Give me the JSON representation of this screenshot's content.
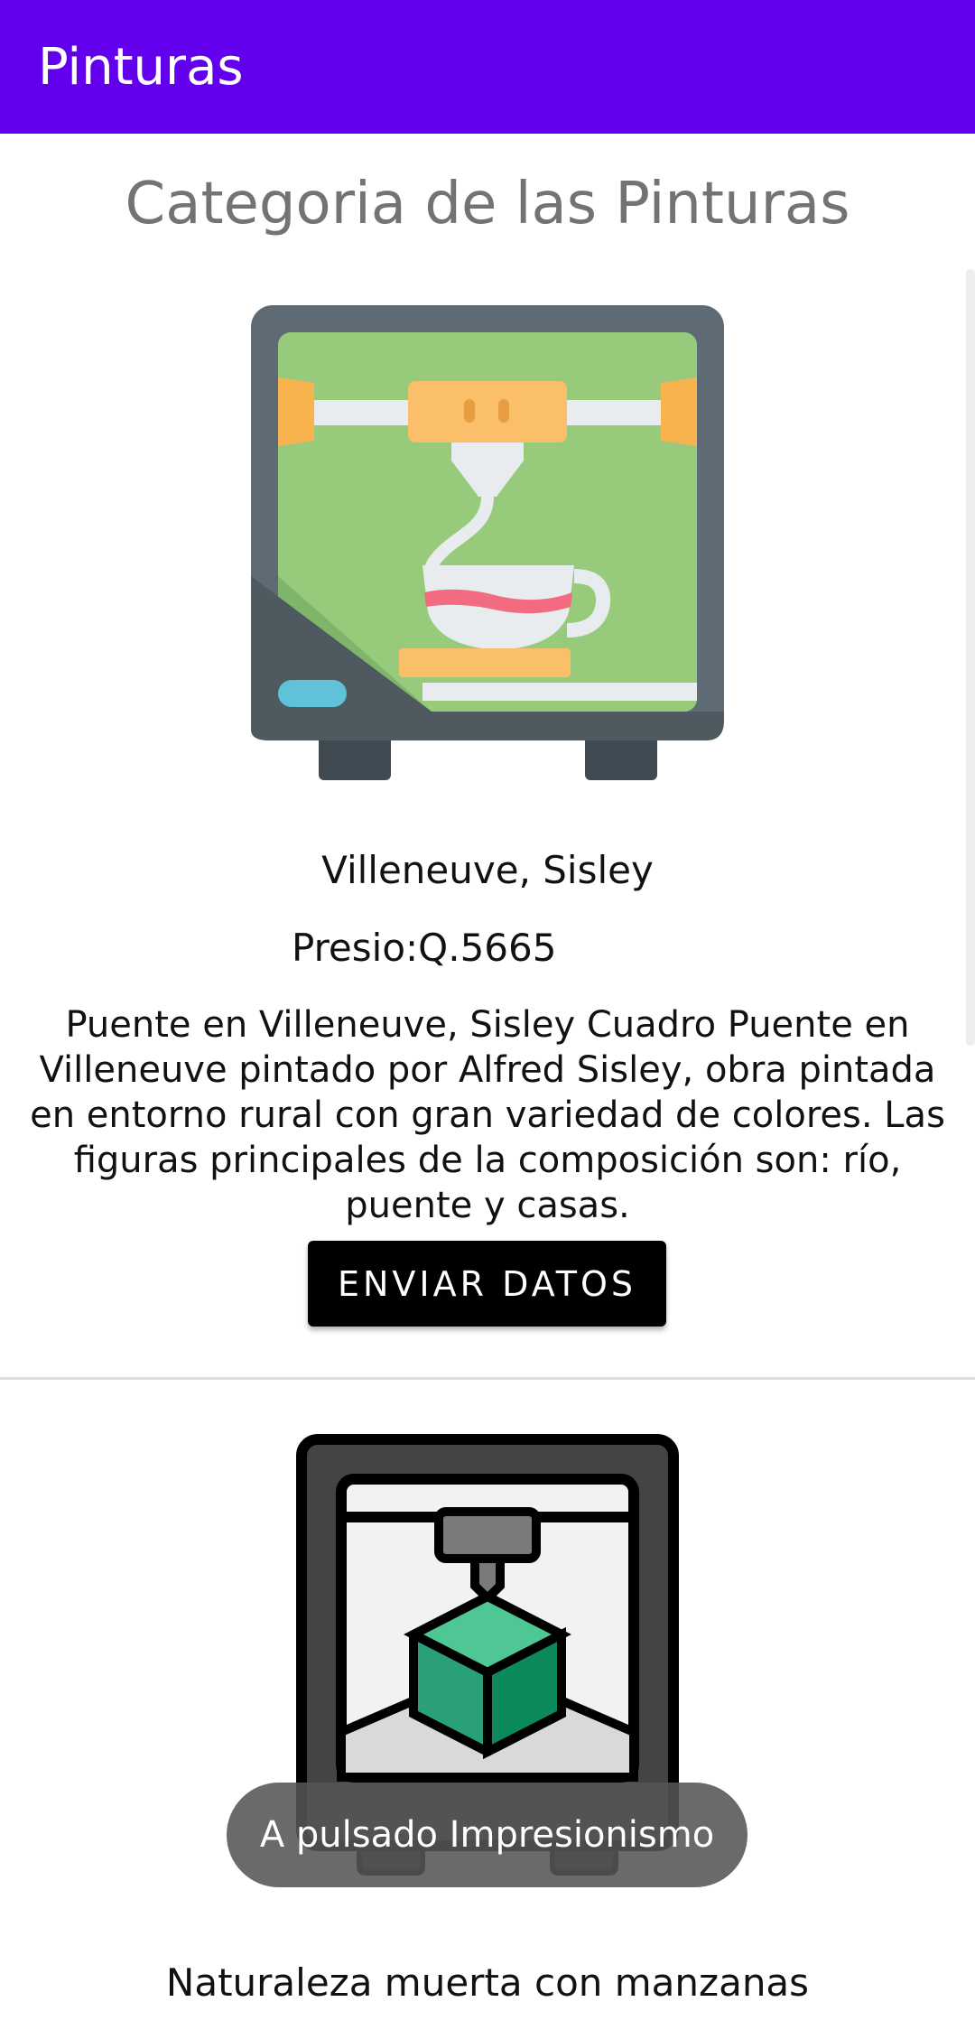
{
  "app_bar": {
    "title": "Pinturas",
    "color": "#6200EE"
  },
  "page": {
    "heading": "Categoria de las Pinturas"
  },
  "items": [
    {
      "icon": "3d-printer-coffee-cup-icon",
      "name": "Villeneuve, Sisley",
      "price": "Presio:Q.5665",
      "description": "Puente en Villeneuve, Sisley Cuadro Puente en Villeneuve pintado por Alfred Sisley, obra pintada en entorno rural con gran variedad de colores. Las figuras principales de la composición son: río, puente y casas.",
      "button_label": "ENVIAR DATOS"
    },
    {
      "icon": "3d-printer-cube-icon",
      "name": "Naturaleza muerta con manzanas"
    }
  ],
  "toast": {
    "text": "A pulsado Impresionismo"
  }
}
